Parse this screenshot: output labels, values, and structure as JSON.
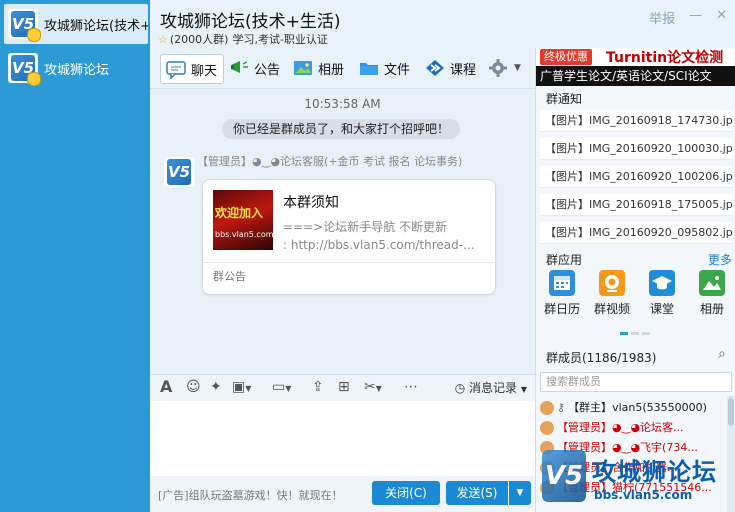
{
  "sidebar": {
    "conversations": [
      {
        "name": "攻城狮论坛(技术+生活)",
        "active": true
      },
      {
        "name": "攻城狮论坛",
        "active": false
      }
    ]
  },
  "header": {
    "title": "攻城狮论坛(技术+生活)",
    "member_count": "(2000人群)",
    "tags": "学习,考试-职业认证",
    "report": "举报",
    "minimize": "—",
    "close": "✕"
  },
  "tabs": [
    {
      "label": "聊天",
      "icon": "chat-icon"
    },
    {
      "label": "公告",
      "icon": "announcement-icon"
    },
    {
      "label": "相册",
      "icon": "album-icon"
    },
    {
      "label": "文件",
      "icon": "folder-icon"
    },
    {
      "label": "课程",
      "icon": "course-icon"
    },
    {
      "label": "",
      "icon": "settings-icon"
    }
  ],
  "chat": {
    "time": "10:53:58 AM",
    "system_message": "你已经是群成员了，和大家打个招呼吧！",
    "sender": "【管理员】◕‿◕论坛客服(+金币 考试 报名 论坛事务)",
    "card": {
      "image_text": "欢迎加入",
      "image_url": "bbs.vlan5.com",
      "title": "本群须知",
      "line1": "===>论坛新手导航 不断更新",
      "line2": ":   http://bbs.vlan5.com/thread-...",
      "footer": "群公告"
    }
  },
  "input_toolbar": {
    "history_label": "消息记录"
  },
  "footer": {
    "ad": "[广告]组队玩盗墓游戏！快！就现在！",
    "close_label": "关闭(C)",
    "send_label": "发送(S)"
  },
  "right": {
    "banner": {
      "tag": "终极优惠",
      "brand": "Turnitin论文检测",
      "line": "广普学生论文/英语论文/SCI论文"
    },
    "notices_title": "群通知",
    "notices": [
      "【图片】IMG_20160918_174730.jpg",
      "【图片】IMG_20160920_100030.jpg",
      "【图片】IMG_20160920_100206.jpg",
      "【图片】IMG_20160918_175005.jpg",
      "【图片】IMG_20160920_095802.jpg"
    ],
    "apps_title": "群应用",
    "more": "更多",
    "apps": [
      {
        "label": "群日历",
        "icon": "calendar-icon",
        "color": "#2e8fdc"
      },
      {
        "label": "群视频",
        "icon": "video-icon",
        "color": "#f39a1c"
      },
      {
        "label": "课堂",
        "icon": "graduation-cap-icon",
        "color": "#1f8ed8"
      },
      {
        "label": "相册",
        "icon": "photo-icon",
        "color": "#3aa84a"
      }
    ],
    "members_title": "群成员(1186/1983)",
    "search_placeholder": "搜索群成员",
    "members": [
      {
        "role": "【群主】",
        "name": "vlan5(53550000)",
        "owner": true
      },
      {
        "role": "【管理员】",
        "name": "◕‿◕论坛客...",
        "owner": false
      },
      {
        "role": "【管理员】",
        "name": "◕‿◕飞宇(734...",
        "owner": false
      },
      {
        "role": "【管理员】",
        "name": "合作加机器...",
        "owner": false
      },
      {
        "role": "【管理员】",
        "name": "猫柠(771551546...",
        "owner": false
      }
    ]
  },
  "watermark": {
    "title": "攻城狮论坛",
    "url": "bbs.vlan5.com"
  }
}
